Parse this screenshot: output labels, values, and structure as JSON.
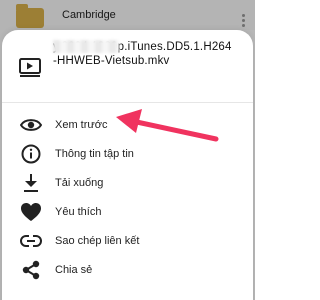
{
  "background": {
    "list_title": "Cambridge"
  },
  "sheet": {
    "file_name": "y.2024.1080p.iTunes.DD5.1.H264-HHWEB-Vietsub.mkv",
    "file_icon": "video-file-icon"
  },
  "menu": {
    "items": [
      {
        "label": "Xem trước",
        "icon": "eye-icon"
      },
      {
        "label": "Thông tin tập tin",
        "icon": "info-icon"
      },
      {
        "label": "Tải xuống",
        "icon": "download-icon"
      },
      {
        "label": "Yêu thích",
        "icon": "heart-icon"
      },
      {
        "label": "Sao chép liên kết",
        "icon": "link-icon"
      },
      {
        "label": "Chia sẻ",
        "icon": "share-icon"
      }
    ]
  },
  "colors": {
    "annotation_arrow": "#f0335f",
    "fab": "#d6545a",
    "folder": "#d8b04a"
  }
}
